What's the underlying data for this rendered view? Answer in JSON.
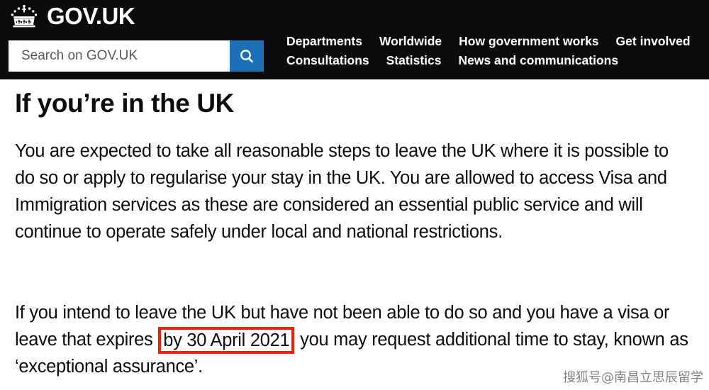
{
  "header": {
    "brand_label": "GOV.UK",
    "crown_icon": "crown-icon",
    "search": {
      "placeholder": "Search on GOV.UK",
      "value": "",
      "button_icon": "search-icon",
      "button_color": "#1d70b8"
    },
    "nav_row_1": [
      {
        "label": "Departments"
      },
      {
        "label": "Worldwide"
      },
      {
        "label": "How government works"
      },
      {
        "label": "Get involved"
      }
    ],
    "nav_row_2": [
      {
        "label": "Consultations"
      },
      {
        "label": "Statistics"
      },
      {
        "label": "News and communications"
      }
    ],
    "background_color": "#0b0c0c"
  },
  "main": {
    "heading": "If you’re in the UK",
    "paragraph_1": "You are expected to take all reasonable steps to leave the UK where it is possible to do so or apply to regularise your stay in the UK. You are allowed to access Visa and Immigration services as these are considered an essential public service and will continue to operate safely under local and national restrictions.",
    "paragraph_2_part_1": "If you intend to leave the UK but have not been able to do so and you have a visa or leave that expires ",
    "paragraph_2_highlight": "by 30 April 2021",
    "paragraph_2_part_2": " you may request additional time to stay, known as ‘exceptional assurance’.",
    "highlight_color": "#e8240c"
  },
  "watermark": {
    "text": "搜狐号@南昌立思辰留学"
  }
}
